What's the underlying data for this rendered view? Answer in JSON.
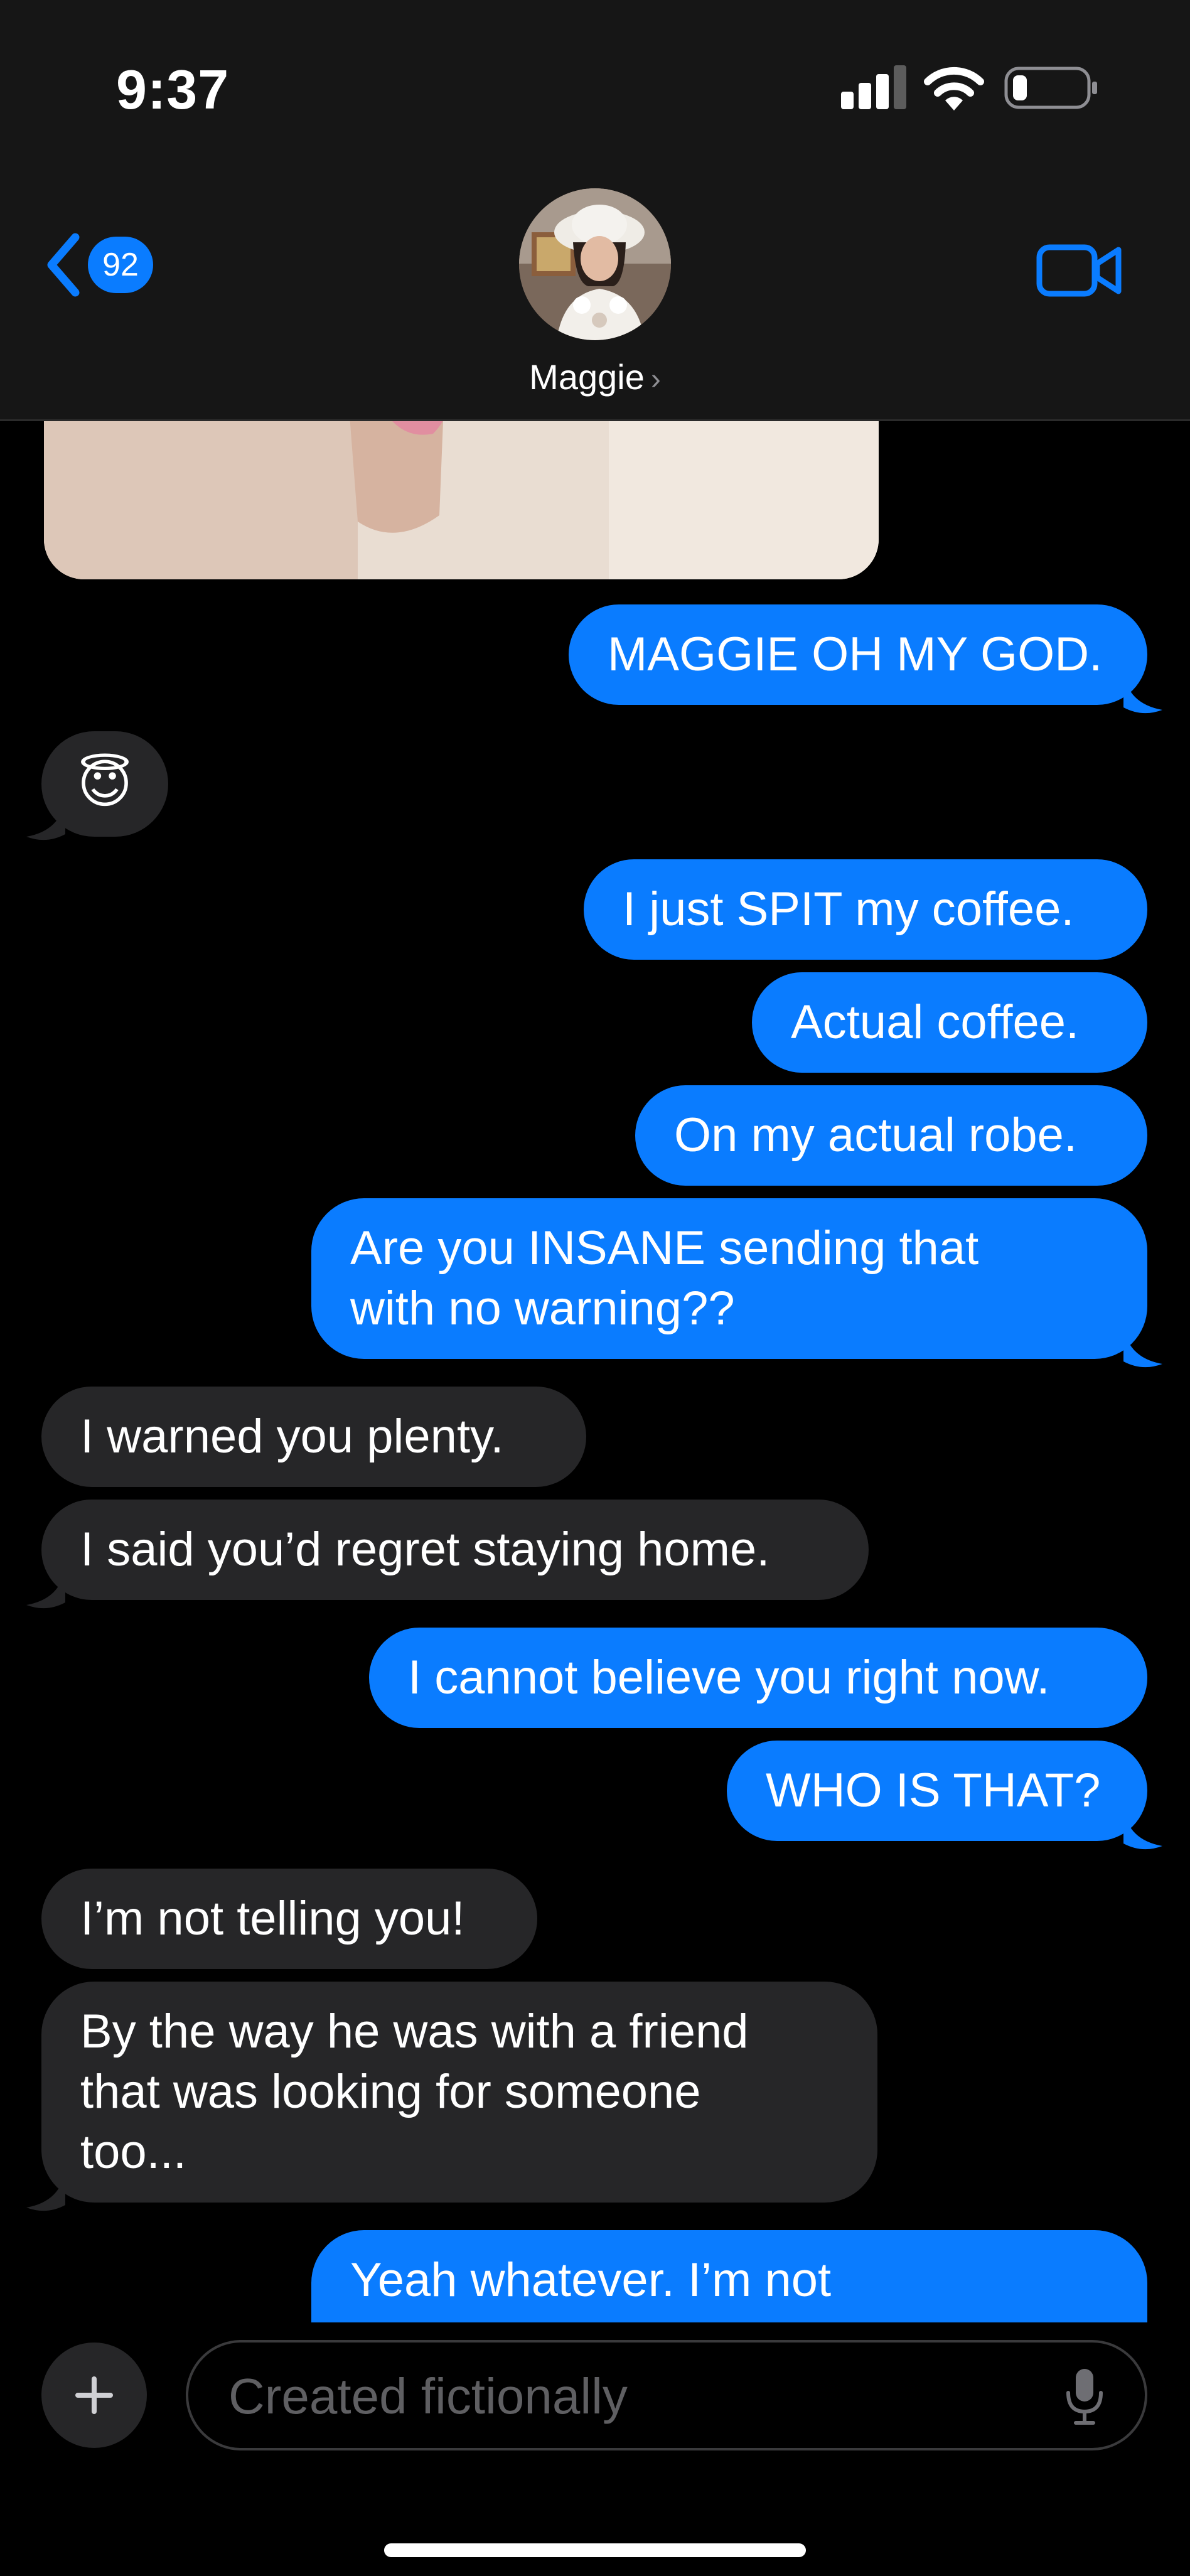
{
  "status_bar": {
    "time": "9:37",
    "battery_level": 0.15,
    "signal_bars": 3
  },
  "header": {
    "back_count": "92",
    "contact_name": "Maggie",
    "chevron": "›",
    "icons": {
      "back": "chevron-left-icon",
      "video": "video-camera-icon"
    }
  },
  "messages": [
    {
      "type": "image",
      "from": "contact"
    },
    {
      "from": "me",
      "text": "MAGGIE OH MY GOD."
    },
    {
      "from": "contact",
      "text": "😇"
    },
    {
      "from": "me",
      "text": "I just SPIT my coffee."
    },
    {
      "from": "me",
      "text": "Actual coffee."
    },
    {
      "from": "me",
      "text": "On my actual robe."
    },
    {
      "from": "me",
      "text": "Are you INSANE sending that\nwith no warning??"
    },
    {
      "from": "contact",
      "text": "I warned you plenty."
    },
    {
      "from": "contact",
      "text": "I said you’d regret staying home."
    },
    {
      "from": "me",
      "text": "I cannot believe you right now."
    },
    {
      "from": "me",
      "text": "WHO IS THAT?"
    },
    {
      "from": "contact",
      "text": "I’m not telling you!"
    },
    {
      "from": "contact",
      "text": "By the way he was with a friend\nthat was looking for someone\ntoo..."
    },
    {
      "from": "me",
      "text": "Yeah whatever. I’m not"
    }
  ],
  "input": {
    "placeholder": "Created fictionally",
    "plus": "+"
  },
  "colors": {
    "sent": "#0a7cff",
    "received": "#262628",
    "background": "#000000",
    "header": "#161616"
  }
}
